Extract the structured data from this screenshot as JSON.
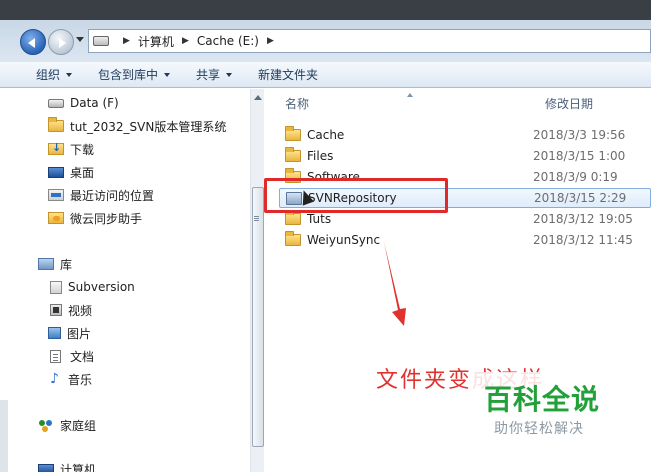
{
  "address": {
    "crumbs": [
      "计算机",
      "Cache (E:)"
    ]
  },
  "toolbar": {
    "organize": "组织",
    "include_in_library": "包含到库中",
    "share": "共享",
    "new_folder": "新建文件夹"
  },
  "nav": {
    "items": [
      {
        "label": "Data (F)",
        "icon": "drive-icon"
      },
      {
        "label": "tut_2032_SVN版本管理系统",
        "icon": "folder-icon"
      },
      {
        "label": "下载",
        "icon": "download-folder-icon"
      },
      {
        "label": "桌面",
        "icon": "desktop-icon"
      },
      {
        "label": "最近访问的位置",
        "icon": "recent-places-icon"
      },
      {
        "label": "微云同步助手",
        "icon": "weiyun-folder-icon"
      }
    ],
    "library": {
      "label": "库",
      "items": [
        {
          "label": "Subversion",
          "icon": "subversion-icon"
        },
        {
          "label": "视频",
          "icon": "video-icon"
        },
        {
          "label": "图片",
          "icon": "picture-icon"
        },
        {
          "label": "文档",
          "icon": "document-icon"
        },
        {
          "label": "音乐",
          "icon": "music-icon"
        }
      ]
    },
    "homegroup": "家庭组",
    "computer": "计算机"
  },
  "filelist": {
    "columns": {
      "name": "名称",
      "modified": "修改日期"
    },
    "rows": [
      {
        "name": "Cache",
        "date": "2018/3/3 19:56"
      },
      {
        "name": "Files",
        "date": "2018/3/15 1:00"
      },
      {
        "name": "Software",
        "date": "2018/3/9 0:19"
      },
      {
        "name": "SVNRepository",
        "date": "2018/3/15 2:29",
        "selected": true
      },
      {
        "name": "Tuts",
        "date": "2018/3/12 19:05"
      },
      {
        "name": "WeiyunSync",
        "date": "2018/3/12 11:45"
      }
    ]
  },
  "annotation": {
    "text": "文件夹变成这样",
    "color": "#e0322f"
  },
  "watermark": {
    "logo": "百科全说",
    "subtitle": "助你轻松解决"
  },
  "colors": {
    "accent": "#2a63b6",
    "annotation_red": "#e02a2a",
    "watermark_green": "#23a03a"
  }
}
